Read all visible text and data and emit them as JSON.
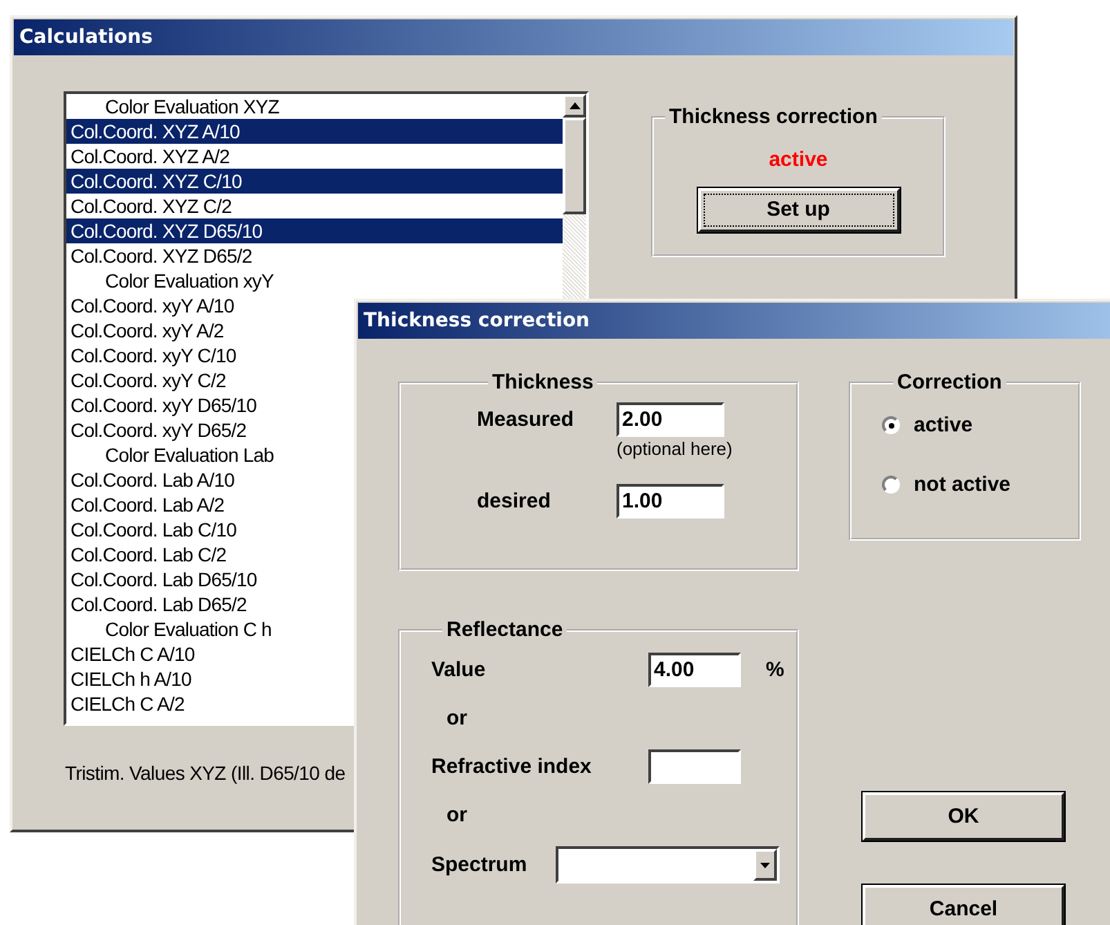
{
  "calculations_window": {
    "title": "Calculations",
    "list": {
      "items": [
        {
          "text": "Color Evaluation XYZ",
          "kind": "header",
          "selected": false
        },
        {
          "text": "Col.Coord. XYZ A/10",
          "kind": "item",
          "selected": true
        },
        {
          "text": "Col.Coord. XYZ A/2",
          "kind": "item",
          "selected": false
        },
        {
          "text": "Col.Coord. XYZ C/10",
          "kind": "item",
          "selected": true
        },
        {
          "text": "Col.Coord. XYZ C/2",
          "kind": "item",
          "selected": false
        },
        {
          "text": "Col.Coord. XYZ D65/10",
          "kind": "item",
          "selected": true
        },
        {
          "text": "Col.Coord. XYZ D65/2",
          "kind": "item",
          "selected": false
        },
        {
          "text": "Color Evaluation xyY",
          "kind": "header",
          "selected": false
        },
        {
          "text": "Col.Coord. xyY A/10",
          "kind": "item",
          "selected": false
        },
        {
          "text": "Col.Coord. xyY A/2",
          "kind": "item",
          "selected": false
        },
        {
          "text": "Col.Coord. xyY C/10",
          "kind": "item",
          "selected": false
        },
        {
          "text": "Col.Coord. xyY C/2",
          "kind": "item",
          "selected": false
        },
        {
          "text": "Col.Coord. xyY D65/10",
          "kind": "item",
          "selected": false
        },
        {
          "text": "Col.Coord. xyY D65/2",
          "kind": "item",
          "selected": false
        },
        {
          "text": "Color Evaluation Lab",
          "kind": "header",
          "selected": false
        },
        {
          "text": "Col.Coord. Lab A/10",
          "kind": "item",
          "selected": false
        },
        {
          "text": "Col.Coord. Lab A/2",
          "kind": "item",
          "selected": false
        },
        {
          "text": "Col.Coord. Lab C/10",
          "kind": "item",
          "selected": false
        },
        {
          "text": "Col.Coord. Lab C/2",
          "kind": "item",
          "selected": false
        },
        {
          "text": "Col.Coord. Lab D65/10",
          "kind": "item",
          "selected": false
        },
        {
          "text": "Col.Coord. Lab D65/2",
          "kind": "item",
          "selected": false
        },
        {
          "text": "Color Evaluation C h",
          "kind": "header",
          "selected": false
        },
        {
          "text": "CIELCh C A/10",
          "kind": "item",
          "selected": false
        },
        {
          "text": "CIELCh h A/10",
          "kind": "item",
          "selected": false
        },
        {
          "text": "CIELCh C A/2",
          "kind": "item",
          "selected": false
        }
      ]
    },
    "thickness_group": {
      "title": "Thickness correction",
      "status": "active",
      "button": "Set up"
    },
    "status_text": "Tristim. Values XYZ (Ill. D65/10 de"
  },
  "dialog": {
    "title": "Thickness correction",
    "thickness": {
      "title": "Thickness",
      "measured_label": "Measured",
      "measured_value": "2.00",
      "measured_hint": "(optional here)",
      "desired_label": "desired",
      "desired_value": "1.00"
    },
    "correction": {
      "title": "Correction",
      "options": [
        {
          "label": "active",
          "selected": true
        },
        {
          "label": "not active",
          "selected": false
        }
      ]
    },
    "reflectance": {
      "title": "Reflectance",
      "value_label": "Value",
      "value": "4.00",
      "unit": "%",
      "or_1": "or",
      "refractive_label": "Refractive index",
      "or_2": "or",
      "spectrum_label": "Spectrum"
    },
    "buttons": [
      "OK",
      "Cancel"
    ]
  }
}
